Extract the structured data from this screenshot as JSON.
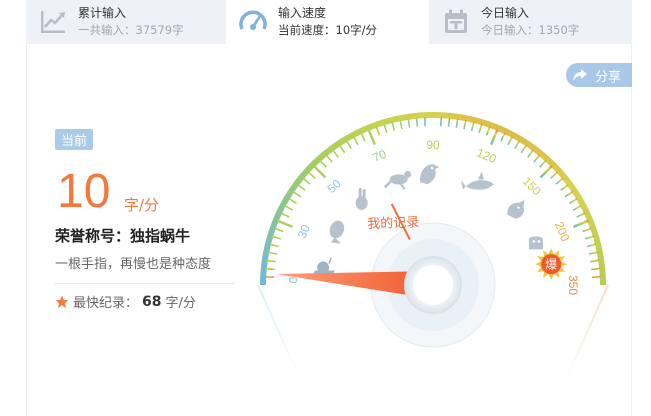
{
  "tabs": [
    {
      "title": "累计输入",
      "sub": "一共输入：37579字"
    },
    {
      "title": "输入速度",
      "sub": "当前速度：10字/分"
    },
    {
      "title": "今日输入",
      "sub": "今日输入：1350字"
    }
  ],
  "share": {
    "label": "分享"
  },
  "current": {
    "badge": "当前",
    "speed": "10",
    "unit": "字/分",
    "honor": "荣誉称号：独指蜗牛",
    "motto": "一根手指，再慢也是种态度",
    "record_label": "最快纪录：",
    "record_value": "68",
    "record_unit": "字/分"
  },
  "gauge": {
    "scale_labels": [
      "0",
      "30",
      "50",
      "70",
      "90",
      "120",
      "150",
      "200",
      "350"
    ],
    "record_tag": "我的记录",
    "burst_label": "爆",
    "needle_value": 10,
    "record_value": 68,
    "icons": [
      "snail-icon",
      "fish-icon",
      "rabbit-icon",
      "kangaroo-icon",
      "eagle-icon",
      "shark-icon",
      "cheetah-icon",
      "rocket-icon"
    ],
    "colors": {
      "blue": "#8fc6e3",
      "green": "#b5d45a",
      "orange": "#f08a3c",
      "needle": "#f36b3a"
    }
  }
}
